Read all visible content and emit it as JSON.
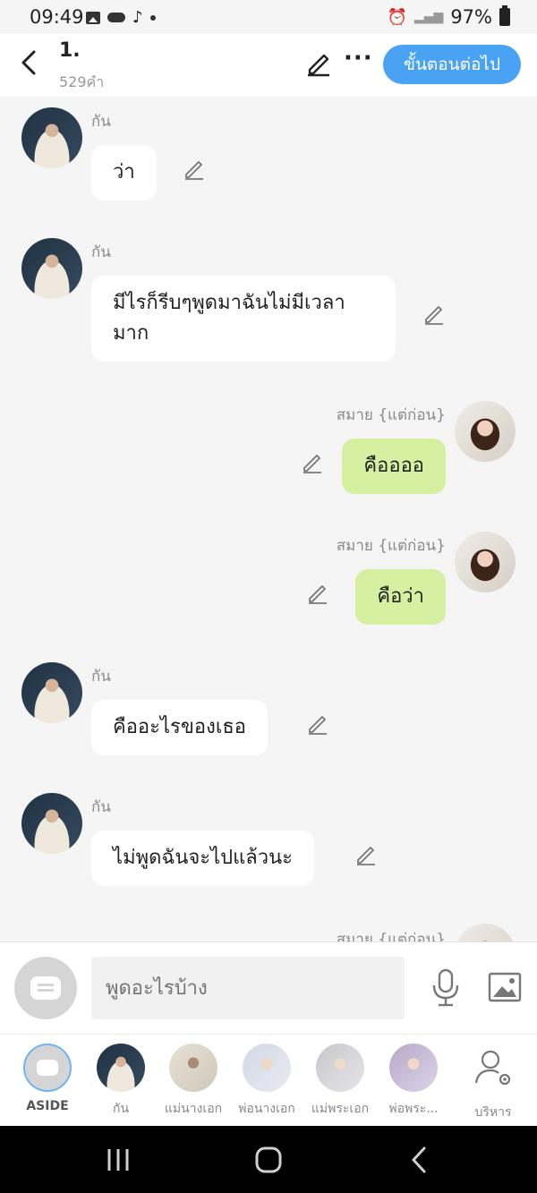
{
  "status": {
    "time": "09:49",
    "battery": "97%"
  },
  "header": {
    "title": "1.",
    "word_count": "529คำ",
    "next_label": "ขั้นตอนต่อไป"
  },
  "messages": [
    {
      "speaker": "กัน",
      "text": "ว่า"
    },
    {
      "speaker": "กัน",
      "text_line1": "มีไรก็รีบๆพูดมาฉันไม่มีเวลา",
      "text_line2": "มาก"
    },
    {
      "speaker": "สมาย {แต่ก่อน}",
      "text": "คืออออ"
    },
    {
      "speaker": "สมาย {แต่ก่อน}",
      "text": "คือว่า"
    },
    {
      "speaker": "กัน",
      "text": "คืออะไรของเธอ"
    },
    {
      "speaker": "กัน",
      "text": "ไม่พูดฉันจะไปแล้วนะ"
    },
    {
      "speaker": "สมาย {แต่ก่อน}"
    }
  ],
  "input": {
    "placeholder": "พูดอะไรบ้าง"
  },
  "characters": [
    {
      "label": "ASIDE"
    },
    {
      "label": "กัน"
    },
    {
      "label": "แม่นางเอก"
    },
    {
      "label": "พ่อนางเอก"
    },
    {
      "label": "แม่พระเอก"
    },
    {
      "label": "พ่อพระ..."
    },
    {
      "label": "บริหาร"
    }
  ],
  "colors": {
    "accent": "#4aa3f2",
    "my_bubble": "#d6f0a1",
    "other_bubble": "#ffffff"
  }
}
